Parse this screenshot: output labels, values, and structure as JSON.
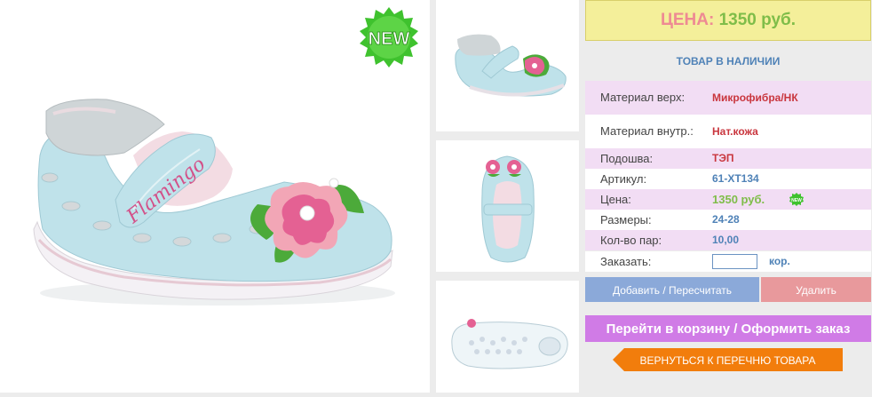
{
  "badge": {
    "text": "NEW"
  },
  "product": {
    "brand_text": "Flamingo",
    "main_image_alt": "Детские туфли Flamingo голубые с цветком"
  },
  "thumbnails": [
    {
      "alt": "Вид сбоку"
    },
    {
      "alt": "Вид сверху"
    },
    {
      "alt": "Вид подошвы"
    }
  ],
  "price_header": {
    "label": "ЦЕНА:",
    "value": "1350 руб."
  },
  "stock_status": "ТОВАР В НАЛИЧИИ",
  "specs": [
    {
      "label": "Материал верх:",
      "value": "Микрофибра/НК"
    },
    {
      "label": "Материал внутр.:",
      "value": "Нат.кожа"
    },
    {
      "label": "Подошва:",
      "value": "ТЭП"
    },
    {
      "label": "Артикул:",
      "value": "61-XT134"
    },
    {
      "label": "Цена:",
      "value": "1350 руб."
    },
    {
      "label": "Размеры:",
      "value": "24-28"
    },
    {
      "label": "Кол-во пар:",
      "value": "10,00"
    }
  ],
  "order": {
    "label": "Заказать:",
    "value": "",
    "unit": "кор."
  },
  "buttons": {
    "add": "Добавить / Пересчитать",
    "delete": "Удалить",
    "cart": "Перейти в корзину / Оформить заказ",
    "back": "ВЕРНУТЬСЯ К ПЕРЕЧНЮ ТОВАРА"
  },
  "colors": {
    "shoe": "#bfe2ea",
    "flower_pink": "#e46193",
    "leaf_green": "#4caa3a",
    "badge_green": "#3fc22e",
    "price_label": "#ee8a93",
    "price_value": "#7fbd49"
  }
}
